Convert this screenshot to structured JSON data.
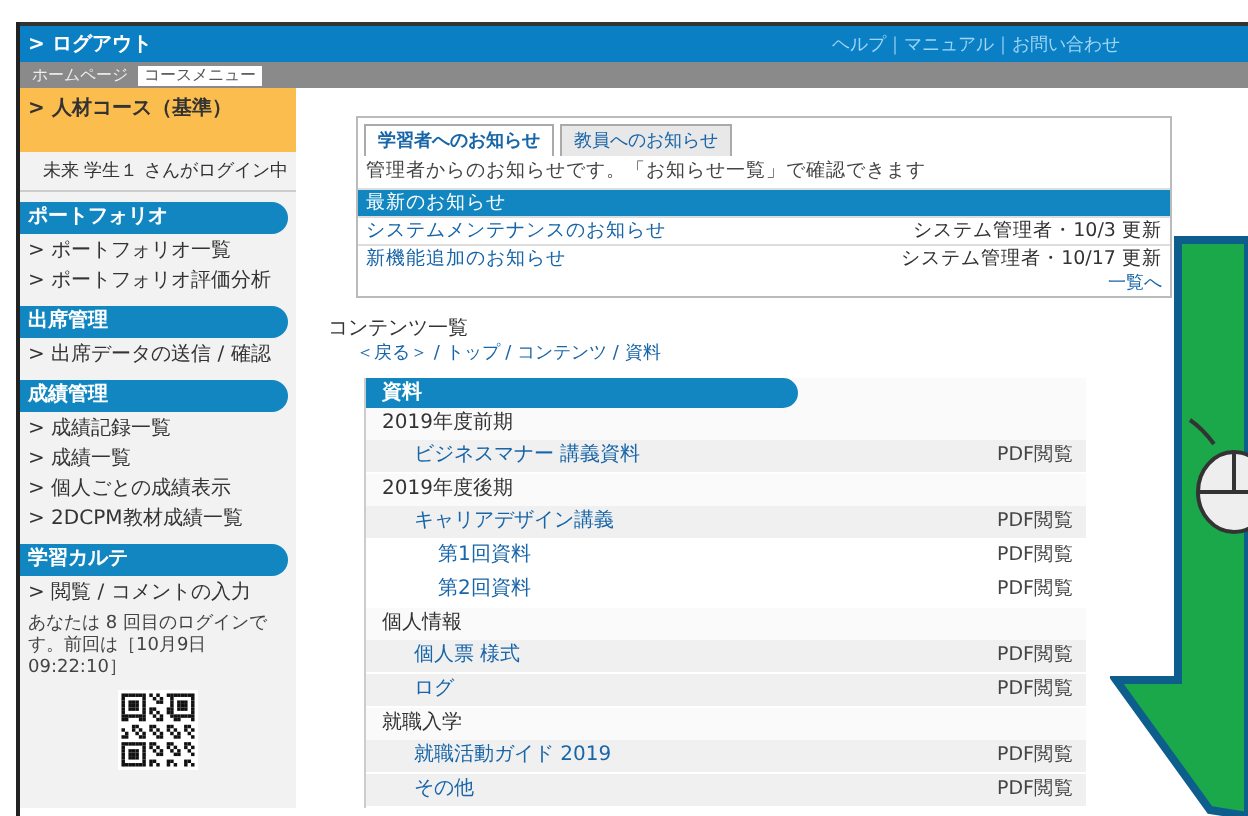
{
  "header": {
    "logout": "> ログアウト",
    "links": "ヘルプ｜マニュアル｜お問い合わせ"
  },
  "nav_tabs": [
    {
      "label": "ホームページ",
      "selected": false
    },
    {
      "label": "コースメニュー",
      "selected": true
    }
  ],
  "sidebar": {
    "course": "> 人材コース（基準）",
    "login_status": "未来 学生１ さんがログイン中",
    "sections": [
      {
        "title": "ポートフォリオ",
        "items": [
          "> ポートフォリオ一覧",
          "> ポートフォリオ評価分析"
        ]
      },
      {
        "title": "出席管理",
        "items": [
          "> 出席データの送信 / 確認"
        ]
      },
      {
        "title": "成績管理",
        "items": [
          "> 成績記録一覧",
          "> 成績一覧",
          "> 個人ごとの成績表示",
          "> 2DCPM教材成績一覧"
        ]
      },
      {
        "title": "学習カルテ",
        "items": [
          "> 閲覧 / コメントの入力"
        ]
      }
    ],
    "login_note": "あなたは 8 回目のログインです。前回は［10月9日 09:22:10］"
  },
  "notices": {
    "tabs": [
      {
        "label": "学習者へのお知らせ",
        "selected": true
      },
      {
        "label": "教員へのお知らせ",
        "selected": false
      }
    ],
    "intro": "管理者からのお知らせです。「お知らせ一覧」で確認できます",
    "rows": [
      {
        "title": "最新のお知らせ",
        "selected": true
      },
      {
        "title": "システムメンテナンスのお知らせ",
        "meta": "システム管理者・10/3 更新",
        "selected": false
      },
      {
        "title": "新機能追加のお知らせ",
        "meta": "システム管理者・10/17 更新",
        "selected": false
      }
    ],
    "more": "一覧へ"
  },
  "contents": {
    "title": "コンテンツ一覧",
    "path": "＜戻る＞ / トップ / コンテンツ / 資料",
    "panel_title": "資料",
    "groups": [
      {
        "title": "2019年度前期",
        "items": [
          {
            "label": "ビジネスマナー 講義資料",
            "note": "PDF閲覧"
          }
        ]
      },
      {
        "title": "2019年度後期",
        "items": [
          {
            "label": "キャリアデザイン講義",
            "note": "PDF閲覧",
            "children": [
              {
                "label": "第1回資料",
                "note": "PDF閲覧"
              },
              {
                "label": "第2回資料",
                "note": "PDF閲覧"
              }
            ]
          }
        ]
      },
      {
        "title": "個人情報",
        "items": [
          {
            "label": "個人票 様式",
            "note": "PDF閲覧"
          },
          {
            "label": "ログ",
            "note": "PDF閲覧"
          }
        ]
      },
      {
        "title": "就職入学",
        "items": [
          {
            "label": "就職活動ガイド 2019",
            "note": "PDF閲覧"
          },
          {
            "label": "その他",
            "note": "PDF閲覧"
          }
        ]
      }
    ]
  }
}
